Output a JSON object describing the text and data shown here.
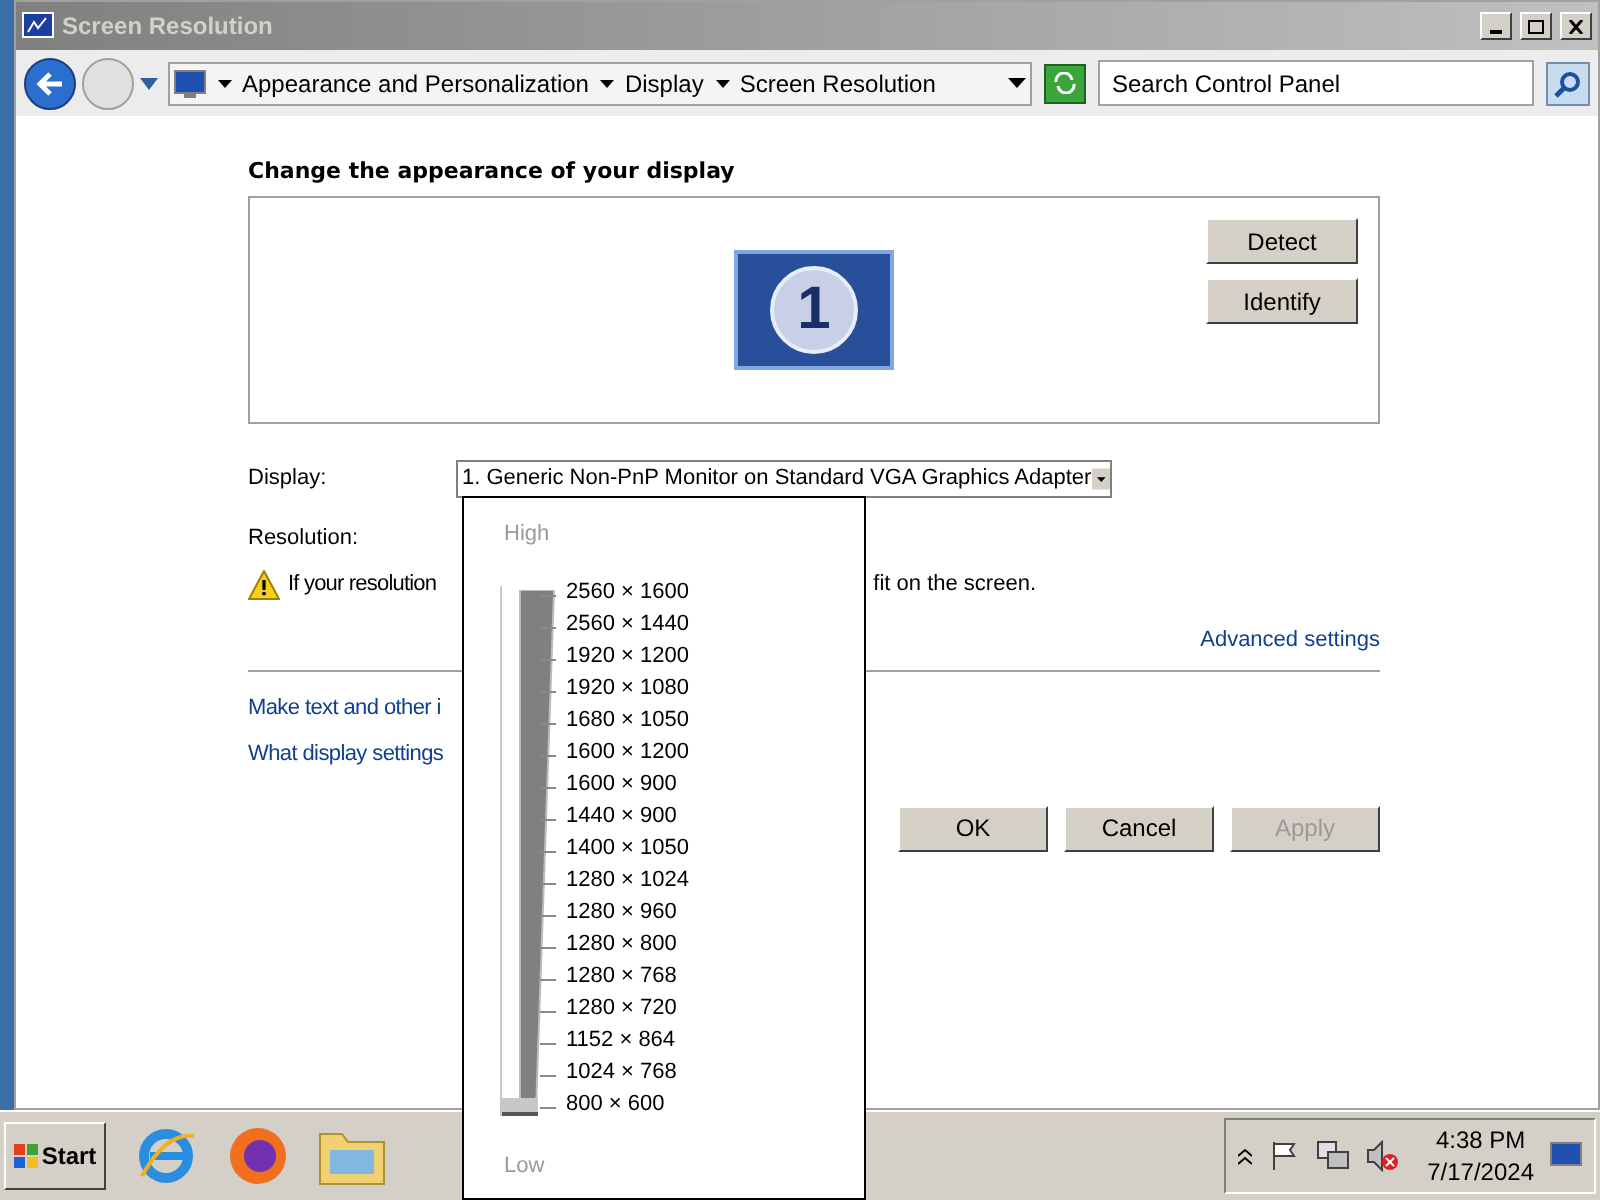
{
  "window": {
    "title": "Screen Resolution"
  },
  "address_bar": {
    "breadcrumbs": [
      "Appearance and Personalization",
      "Display",
      "Screen Resolution"
    ]
  },
  "search": {
    "placeholder": "Search Control Panel"
  },
  "heading": "Change the appearance of your display",
  "monitor": {
    "number": "1"
  },
  "monitor_buttons": [
    "Detect",
    "Identify"
  ],
  "display": {
    "label": "Display:",
    "value": "1. Generic Non-PnP Monitor on Standard VGA Graphics Adapter"
  },
  "resolution": {
    "label": "Resolution:"
  },
  "warning": {
    "text_start": "If your resolution",
    "text_end": "fit on the screen."
  },
  "advanced_link": "Advanced settings",
  "links": [
    "Make text and other i",
    "What display settings"
  ],
  "buttons": [
    {
      "label": "OK",
      "disabled": false
    },
    {
      "label": "Cancel",
      "disabled": false
    },
    {
      "label": "Apply",
      "disabled": true
    }
  ],
  "resolution_popup": {
    "high_label": "High",
    "low_label": "Low",
    "level": 0,
    "options": [
      "2560 × 1600",
      "2560 × 1440",
      "1920 × 1200",
      "1920 × 1080",
      "1680 × 1050",
      "1600 × 1200",
      "1600 × 900",
      "1440 × 900",
      "1400 × 1050",
      "1280 × 1024",
      "1280 × 960",
      "1280 × 800",
      "1280 × 768",
      "1280 × 720",
      "1152 × 864",
      "1024 × 768",
      "800 × 600"
    ]
  },
  "taskbar": {
    "start_label": "Start",
    "time": "4:38 PM",
    "date": "7/17/2024"
  }
}
